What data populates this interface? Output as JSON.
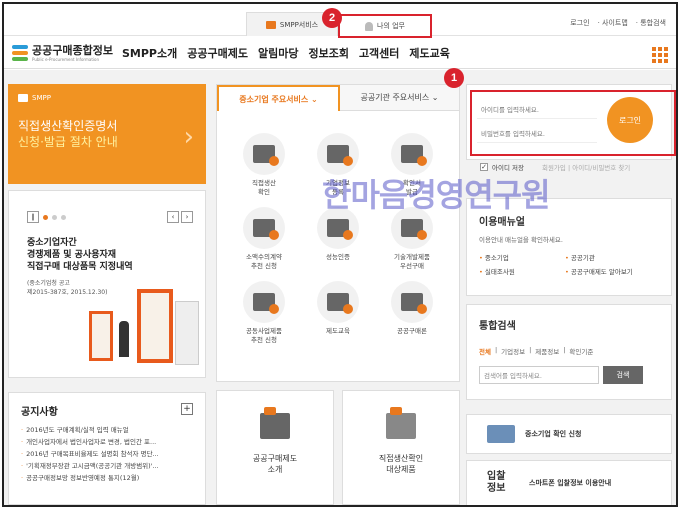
{
  "topbar": {
    "smpp_tab": "SMPP서비스",
    "my_tab": "나의 업무",
    "utils": [
      "로그인",
      "사이트맵",
      "통합검색"
    ]
  },
  "badges": {
    "b1": "1",
    "b2": "2"
  },
  "logo": {
    "title": "공공구매종합정보",
    "sub": "Public e-Procurement Information"
  },
  "nav": {
    "items": [
      "SMPP소개",
      "공공구매제도",
      "알림마당",
      "정보조회",
      "고객센터",
      "제도교육"
    ]
  },
  "banner": {
    "tag": "SMPP",
    "line1": "직접생산확인증명서",
    "line2": "신청·발급 절차 안내"
  },
  "slide": {
    "title": "중소기업자간\n경쟁제품 및 공사용자재\n직접구매 대상품목 지정내역",
    "sub": "(중소기업청 공고\n제2015-387호, 2015.12.30)"
  },
  "notice": {
    "heading": "공지사항",
    "items": [
      "2016년도 구매계획/실적 입력 매뉴얼",
      "개인사업자에서 법인사업자로 변경, 법인간 포...",
      "2016년 구매목표비율제도 설명회 참석자 명단...",
      "'기획재정부장관 고시금액(공공기관 개방범위)'...",
      "공공구매정보망 정보반영예정 통지(12월)"
    ]
  },
  "services": {
    "tab_sme": "중소기업 주요서비스",
    "tab_public": "공공기관 주요서비스",
    "items": [
      "직접생산\n확인",
      "기업정보\n등록",
      "확인서\n발급",
      "소액수의계약\n추천 신청",
      "성능인증",
      "기술개발제품\n우선구매",
      "공동사업제품\n추천 신청",
      "제도교육",
      "공공구매론"
    ]
  },
  "bottom": {
    "box1": "공공구매제도\n소개",
    "box2": "직접생산확인\n대상제품"
  },
  "login": {
    "id_placeholder": "아이디를 입력하세요.",
    "pw_placeholder": "비밀번호를 입력하세요.",
    "button": "로그인",
    "save_id": "아이디 저장",
    "join": "회원가입 | 아이디/비밀번호 찾기"
  },
  "watermark": "한마음경영연구원",
  "guide": {
    "heading": "이용매뉴얼",
    "desc": "이용안내 매뉴얼을 확인하세요.",
    "items": [
      "중소기업",
      "공공기관",
      "실태조사원",
      "공공구매제도 알아보기"
    ]
  },
  "search": {
    "heading": "통합검색",
    "tabs": [
      "전체",
      "기업정보",
      "제품정보",
      "확인기준"
    ],
    "placeholder": "검색어를 입력하세요.",
    "button": "검색"
  },
  "quick": {
    "sme_check": "중소기업 확인 신청",
    "bid_icon_text": "입찰\n정보",
    "bid": "스마트폰 입찰정보 이용안내"
  },
  "colors": {
    "accent": "#f19322",
    "highlight": "#d9232d"
  }
}
